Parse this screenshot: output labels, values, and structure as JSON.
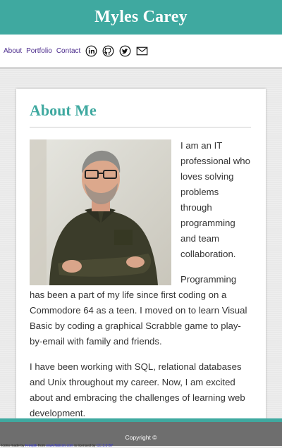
{
  "header": {
    "title": "Myles Carey"
  },
  "nav": {
    "links": [
      "About",
      "Portfolio",
      "Contact"
    ],
    "icons": [
      "linkedin-icon",
      "github-icon",
      "twitter-icon",
      "mail-icon"
    ]
  },
  "about": {
    "heading": "About Me",
    "paragraphs": [
      "I am an IT professional who loves solving problems through programming and team collaboration.",
      "Programming has been a part of my life since first coding on a Commodore 64 as a teen.  I moved on to learn Visual Basic by coding a graphical Scrabble game to play-by-email with family and friends.",
      "I have been working with SQL, relational databases and Unix throughout my career.  Now, I am excited about and embracing the challenges of learning web development."
    ]
  },
  "footer": {
    "copyright": "Copyright ©",
    "credit_prefix": "Icons made by",
    "credit_author": "Freepik",
    "credit_from": "from",
    "credit_site": "www.flaticon.com",
    "credit_licensed": "is licensed by",
    "credit_license": "CC 3.0 BY"
  },
  "colors": {
    "accent": "#3fa9a0",
    "nav_link": "#4b2b8c",
    "footer": "#6e6e6e"
  }
}
